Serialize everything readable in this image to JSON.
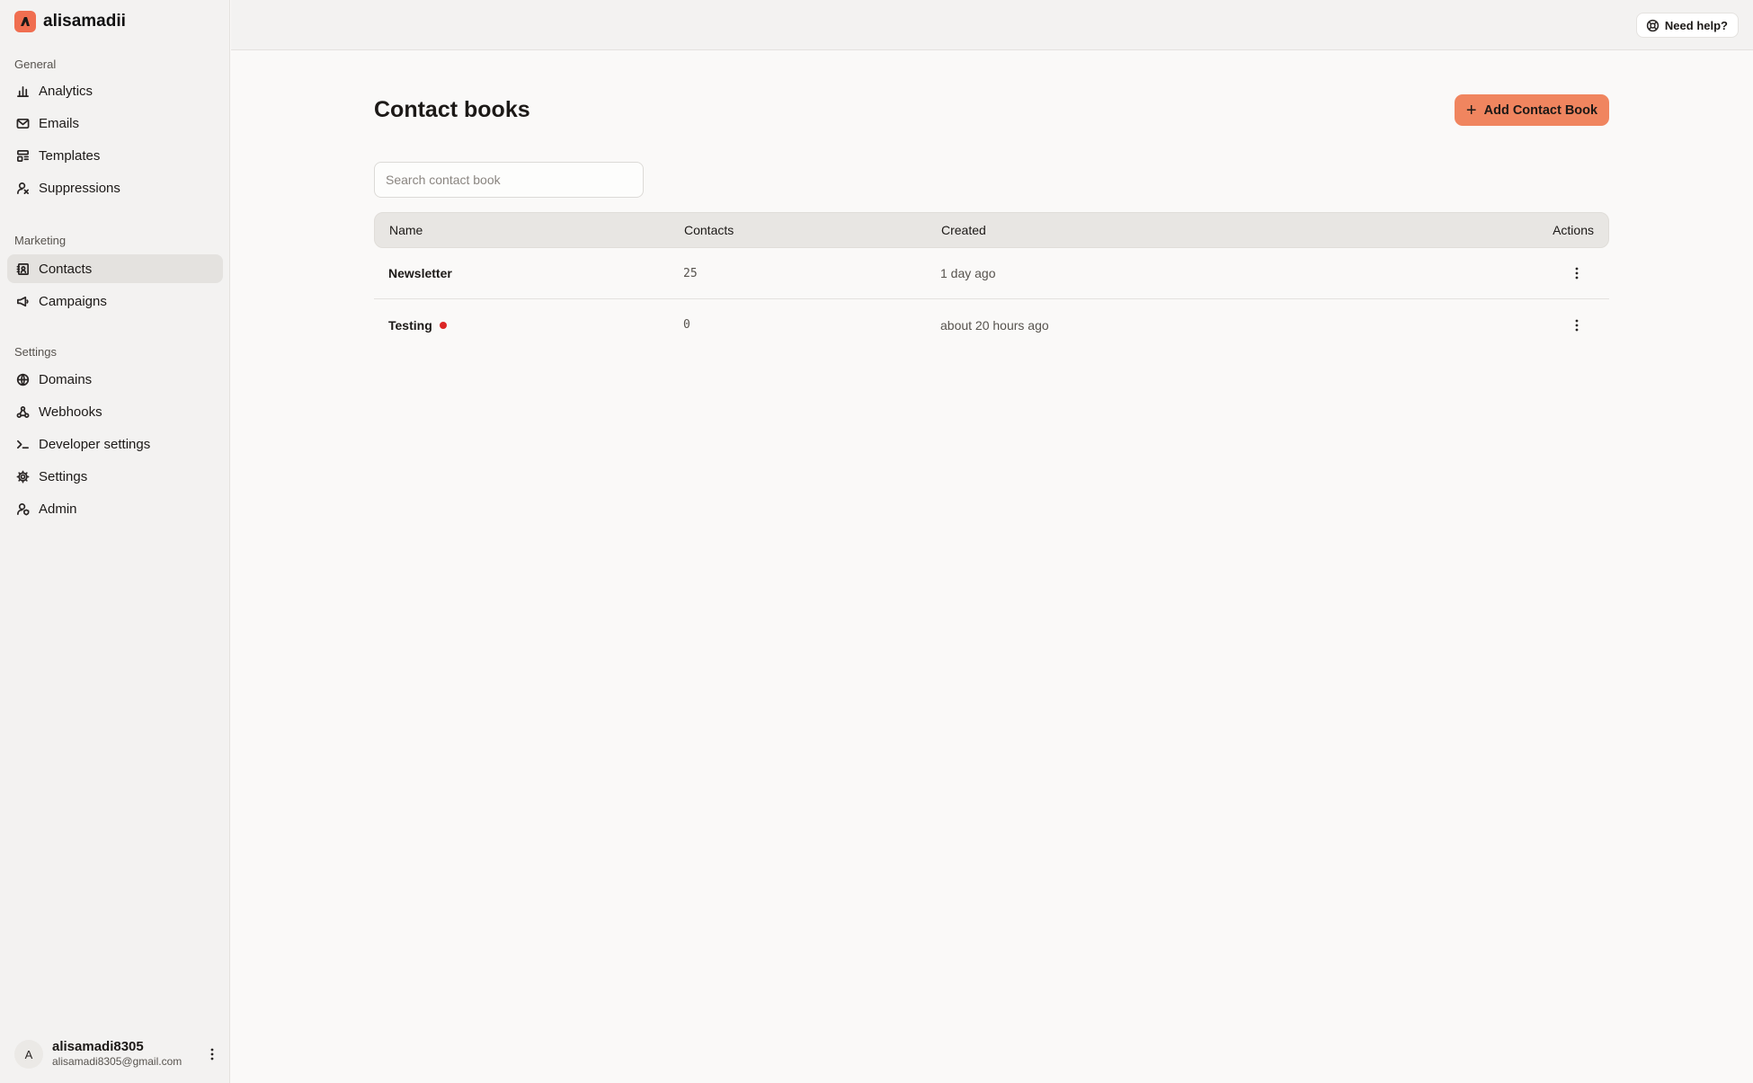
{
  "app": {
    "team_name": "alisamadii",
    "logo_icon": "brand-logo-icon",
    "accent_color": "#f06e50"
  },
  "sidebar": {
    "sections": [
      {
        "heading": "General",
        "items": [
          {
            "label": "Analytics",
            "icon": "bar-chart-icon"
          },
          {
            "label": "Emails",
            "icon": "mail-icon"
          },
          {
            "label": "Templates",
            "icon": "layout-template-icon"
          },
          {
            "label": "Suppressions",
            "icon": "user-block-icon"
          }
        ]
      },
      {
        "heading": "Marketing",
        "items": [
          {
            "label": "Contacts",
            "icon": "contact-book-icon",
            "active": true
          },
          {
            "label": "Campaigns",
            "icon": "megaphone-icon"
          }
        ]
      },
      {
        "heading": "Settings",
        "items": [
          {
            "label": "Domains",
            "icon": "globe-icon"
          },
          {
            "label": "Webhooks",
            "icon": "webhook-icon"
          },
          {
            "label": "Developer settings",
            "icon": "terminal-icon"
          },
          {
            "label": "Settings",
            "icon": "gear-icon"
          },
          {
            "label": "Admin",
            "icon": "user-shield-icon"
          }
        ]
      }
    ]
  },
  "user": {
    "avatar_initial": "A",
    "name": "alisamadi8305",
    "email": "alisamadi8305@gmail.com"
  },
  "topbar": {
    "help_label": "Need help?"
  },
  "page": {
    "title": "Contact books",
    "add_button_label": "Add Contact Book",
    "search_placeholder": "Search contact book",
    "table": {
      "columns": [
        "Name",
        "Contacts",
        "Created",
        "Actions"
      ],
      "rows": [
        {
          "name": "Newsletter",
          "contacts": "25",
          "created": "1 day ago",
          "status_dot": false
        },
        {
          "name": "Testing",
          "contacts": "0",
          "created": "about 20 hours ago",
          "status_dot": true,
          "status_color": "#dc2626"
        }
      ]
    }
  }
}
